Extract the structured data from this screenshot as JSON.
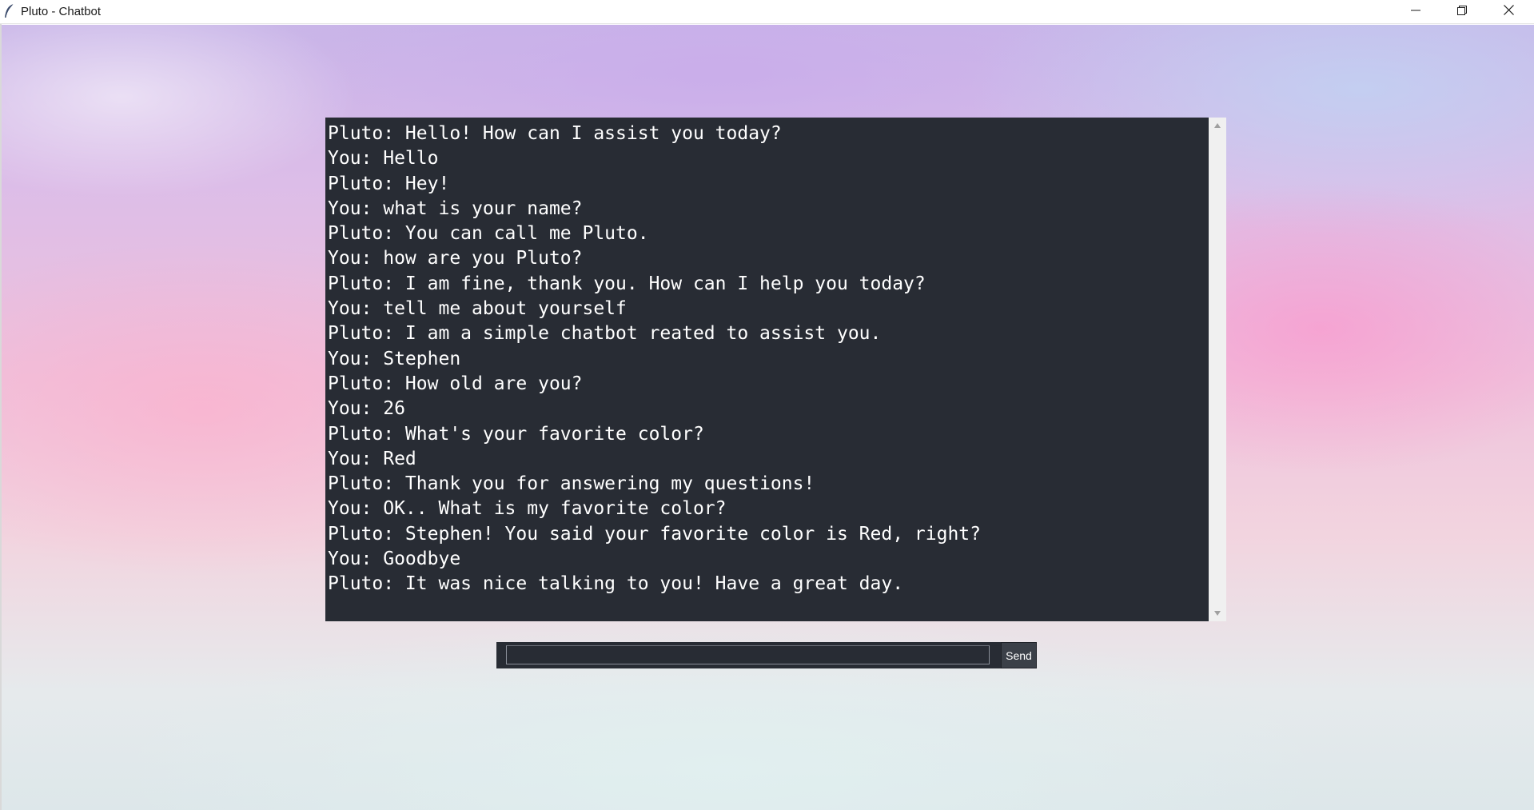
{
  "window": {
    "title": "Pluto - Chatbot",
    "app_icon": "feather-icon",
    "controls": [
      "minimize-icon",
      "maximize-icon",
      "close-icon"
    ]
  },
  "chat": {
    "lines": [
      "Pluto: Hello! How can I assist you today?",
      "You: Hello",
      "Pluto: Hey!",
      "You: what is your name?",
      "Pluto: You can call me Pluto.",
      "You: how are you Pluto?",
      "Pluto: I am fine, thank you. How can I help you today?",
      "You: tell me about yourself",
      "Pluto: I am a simple chatbot reated to assist you.",
      "You: Stephen",
      "Pluto: How old are you?",
      "You: 26",
      "Pluto: What's your favorite color?",
      "You: Red",
      "Pluto: Thank you for answering my questions!",
      "You: OK.. What is my favorite color?",
      "Pluto: Stephen! You said your favorite color is Red, right?",
      "You: Goodbye",
      "Pluto: It was nice talking to you! Have a great day."
    ]
  },
  "input": {
    "value": "",
    "send_label": "Send"
  },
  "colors": {
    "chat_background": "#282c34",
    "chat_text": "#ffffff",
    "button_background": "#3b4048"
  }
}
